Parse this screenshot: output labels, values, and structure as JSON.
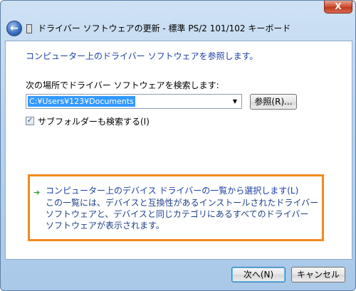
{
  "window": {
    "close_symbol": "X",
    "title": "ドライバー ソフトウェアの更新 - 標準 PS/2 101/102 キーボード",
    "back_symbol": "←"
  },
  "content": {
    "heading": "コンピューター上のドライバー ソフトウェアを参照します。",
    "search_label": "次の場所でドライバー ソフトウェアを検索します:",
    "path_value": "C:¥Users¥123¥Documents",
    "combo_arrow": "▼",
    "browse_label": "参照(R)...",
    "subfolder_checked": true,
    "subfolder_check_mark": "✓",
    "subfolder_label": "サブフォルダーも検索する(I)",
    "arrow_symbol": "➔",
    "list_option_link": "コンピューター上のデバイス ドライバーの一覧から選択します(L)",
    "list_option_description": "この一覧には、デバイスと互換性があるインストールされたドライバー ソフトウェアと、デバイスと同じカテゴリにあるすべてのドライバー ソフトウェアが表示されます。"
  },
  "footer": {
    "next_label": "次へ(N)",
    "cancel_label": "キャンセル"
  },
  "colors": {
    "highlight_border": "#f08a1c",
    "link_blue": "#1a3ea8",
    "selection_blue": "#3399ff"
  }
}
